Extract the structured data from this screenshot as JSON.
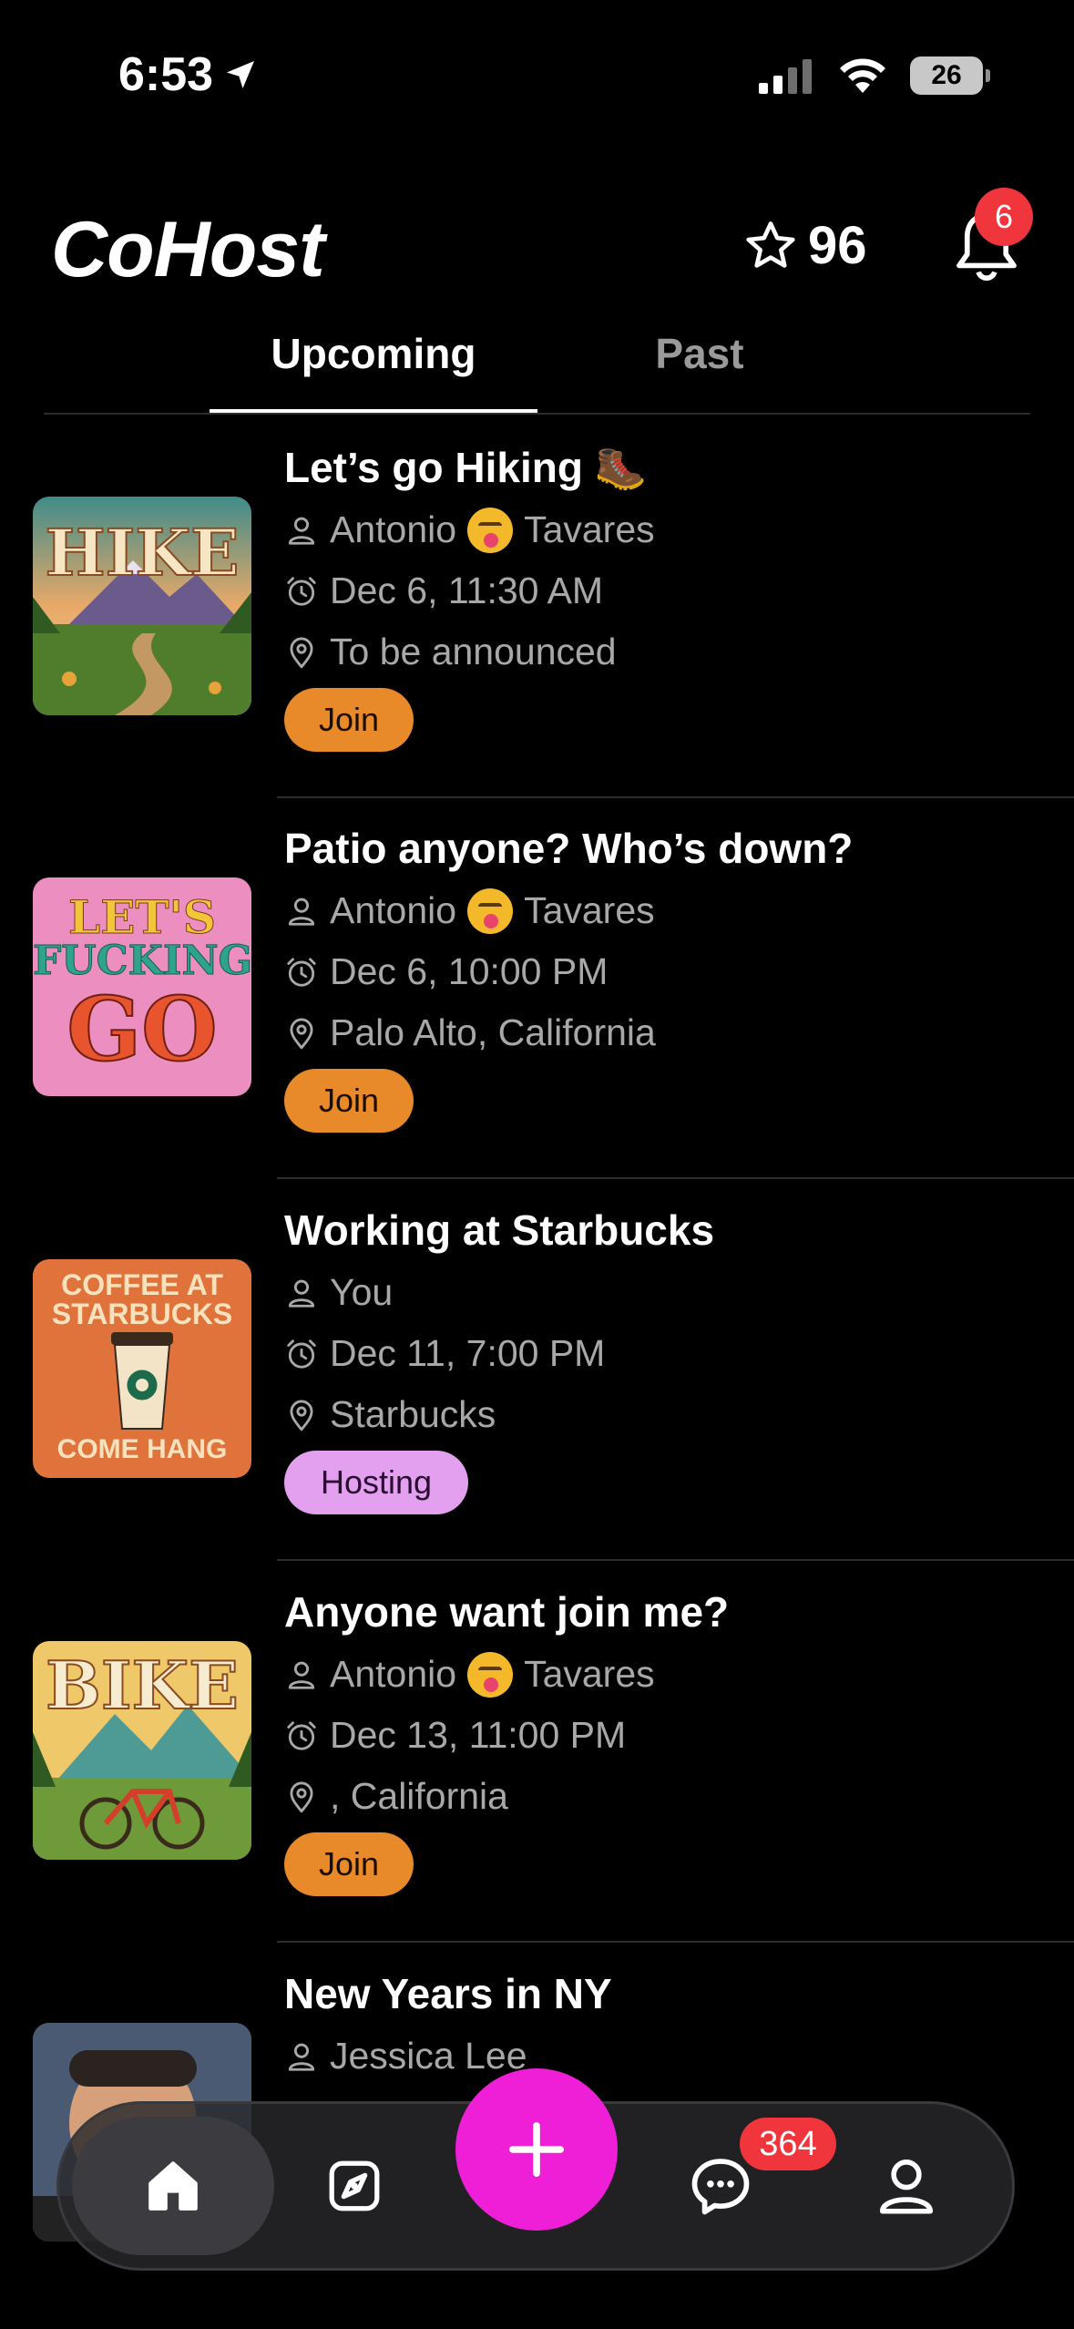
{
  "status_bar": {
    "time": "6:53",
    "battery": "26"
  },
  "header": {
    "logo": "CoHost",
    "points": "96",
    "notification_count": "6"
  },
  "tabs": [
    {
      "label": "Upcoming"
    },
    {
      "label": "Past"
    }
  ],
  "events": [
    {
      "title": "Let’s go Hiking 🥾",
      "host_first": "Antonio",
      "host_last": "Tavares",
      "host_emoji": true,
      "datetime": "Dec 6, 11:30 AM",
      "location": "To be announced",
      "action": "Join",
      "thumb_text": "HIKE"
    },
    {
      "title": "Patio anyone? Who’s down?",
      "host_first": "Antonio",
      "host_last": "Tavares",
      "host_emoji": true,
      "datetime": "Dec 6, 10:00 PM",
      "location": "Palo Alto, California",
      "action": "Join",
      "thumb_text": [
        "LET'S",
        "FUCKING",
        "GO"
      ]
    },
    {
      "title": "Working at Starbucks",
      "host_first": "You",
      "host_last": "",
      "host_emoji": false,
      "datetime": "Dec 11, 7:00 PM",
      "location": "Starbucks",
      "action": "Hosting",
      "thumb_text": [
        "COFFEE AT",
        "STARBUCKS",
        "COME HANG"
      ]
    },
    {
      "title": "Anyone want join me?",
      "host_first": "Antonio",
      "host_last": "Tavares",
      "host_emoji": true,
      "datetime": "Dec 13, 11:00 PM",
      "location": ", California",
      "action": "Join",
      "thumb_text": "BIKE"
    },
    {
      "title": "New Years in NY",
      "host_first": "Jessica Lee",
      "host_last": "",
      "host_emoji": false,
      "datetime": "",
      "location": "",
      "action": "",
      "thumb_text": ""
    }
  ],
  "bottom_nav": {
    "messages_badge": "364"
  },
  "colors": {
    "join": "#e88a2a",
    "hosting": "#e3a0ee",
    "fab": "#ee1fd6",
    "badge": "#f0353d"
  }
}
